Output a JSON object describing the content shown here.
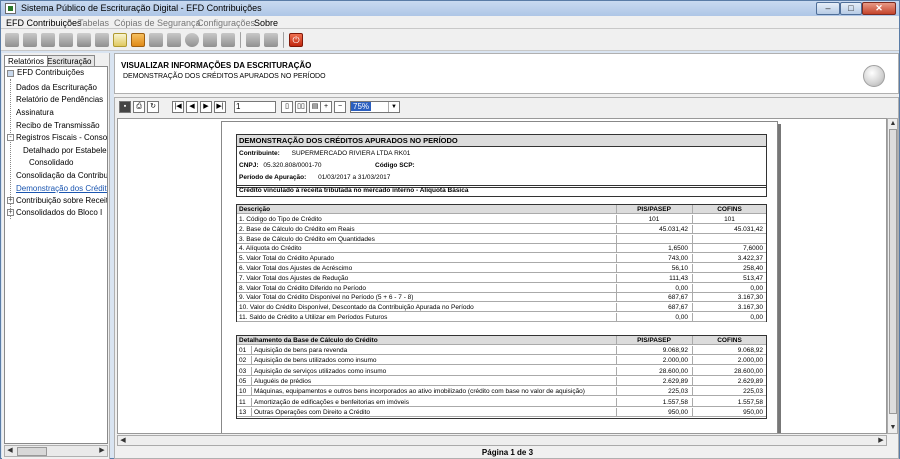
{
  "window": {
    "title": "Sistema Público de Escrituração Digital - EFD Contribuições"
  },
  "menu": [
    "EFD Contribuições",
    "Tabelas",
    "Cópias de Segurança",
    "Configurações",
    "Sobre"
  ],
  "left_panel": {
    "tabs": [
      "Relatórios",
      "Escrituração"
    ],
    "tree": [
      "EFD Contribuições",
      "Dados da Escrituração",
      "Relatório de Pendências",
      "Assinatura",
      "Recibo de Transmissão",
      "Registros Fiscais - Consolid",
      "Detalhado por Estabelec",
      "Consolidado",
      "Consolidação da Contribuiçã",
      "Demonstração dos Créditos",
      "Contribuição sobre Receita B",
      "Consolidados do Bloco I"
    ]
  },
  "header": {
    "title": "VISUALIZAR INFORMAÇÕES DA ESCRITURAÇÃO",
    "subtitle": "DEMONSTRAÇÃO DOS CRÉDITOS APURADOS NO PERÍODO"
  },
  "viewer": {
    "page_number": "1",
    "zoom": "75%",
    "status": "Página 1 de 3"
  },
  "report": {
    "title": "DEMONSTRAÇÃO DOS CRÉDITOS APURADOS NO PERÍODO",
    "contribuinte_label": "Contribuinte:",
    "contribuinte": "SUPERMERCADO RIVIERA LTDA RK01",
    "cnpj_label": "CNPJ:",
    "cnpj": "05.320.808/0001-70",
    "scp_label": "Código SCP:",
    "periodo_label": "Período de Apuração:",
    "periodo": "01/03/2017 a 31/03/2017",
    "credito_vinculado": "Crédito vinculado à receita tributada no mercado interno - Alíquota Básica",
    "table1": {
      "headers": [
        "Descrição",
        "PIS/PASEP",
        "COFINS"
      ],
      "rows": [
        [
          "1. Código do Tipo de Crédito",
          "101",
          "101"
        ],
        [
          "2. Base de Cálculo do Crédito em Reais",
          "45.031,42",
          "45.031,42"
        ],
        [
          "3. Base de Cálculo do Crédito em Quantidades",
          "",
          ""
        ],
        [
          "4. Alíquota do Crédito",
          "1,6500",
          "7,6000"
        ],
        [
          "5. Valor Total do Crédito Apurado",
          "743,00",
          "3.422,37"
        ],
        [
          "6. Valor Total dos Ajustes de Acréscimo",
          "56,10",
          "258,40"
        ],
        [
          "7. Valor Total dos Ajustes de Redução",
          "111,43",
          "513,47"
        ],
        [
          "8. Valor Total do Crédito Diferido no Período",
          "0,00",
          "0,00"
        ],
        [
          "9. Valor Total do Crédito Disponível no Período (5 + 6 - 7 - 8)",
          "687,67",
          "3.167,30"
        ],
        [
          "10. Valor do Crédito Disponível, Descontado da Contribuição Apurada no Período",
          "687,67",
          "3.167,30"
        ],
        [
          "11. Saldo de Crédito a Utilizar em Períodos Futuros",
          "0,00",
          "0,00"
        ]
      ]
    },
    "table2": {
      "headers": [
        "Detalhamento da Base de Cálculo do Crédito",
        "PIS/PASEP",
        "COFINS"
      ],
      "rows": [
        [
          "01",
          "Aquisição de bens para revenda",
          "9.068,92",
          "9.068,92"
        ],
        [
          "02",
          "Aquisição de bens utilizados como insumo",
          "2.000,00",
          "2.000,00"
        ],
        [
          "03",
          "Aquisição de serviços utilizados como insumo",
          "28.600,00",
          "28.600,00"
        ],
        [
          "05",
          "Aluguéis de prédios",
          "2.629,89",
          "2.629,89"
        ],
        [
          "10",
          "Máquinas, equipamentos e outros bens incorporados ao ativo imobilizado (crédito com base no valor de aquisição)",
          "225,03",
          "225,03"
        ],
        [
          "11",
          "Amortização de edificações e benfeitorias em imóveis",
          "1.557,58",
          "1.557,58"
        ],
        [
          "13",
          "Outras Operações com Direito a Crédito",
          "950,00",
          "950,00"
        ]
      ]
    }
  }
}
